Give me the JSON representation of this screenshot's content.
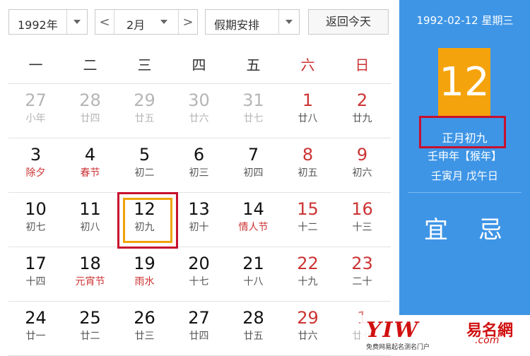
{
  "toolbar": {
    "year_select": "1992年",
    "month_select": "2月",
    "prev_arrow": "<",
    "next_arrow": ">",
    "holiday_select": "假期安排",
    "today_button": "返回今天"
  },
  "weekdays": [
    "一",
    "二",
    "三",
    "四",
    "五",
    "六",
    "日"
  ],
  "days": [
    {
      "num": "27",
      "sub": "小年",
      "other": true
    },
    {
      "num": "28",
      "sub": "廿四",
      "other": true
    },
    {
      "num": "29",
      "sub": "廿五",
      "other": true
    },
    {
      "num": "30",
      "sub": "廿六",
      "other": true
    },
    {
      "num": "31",
      "sub": "廿七",
      "other": true
    },
    {
      "num": "1",
      "sub": "廿八"
    },
    {
      "num": "2",
      "sub": "廿九"
    },
    {
      "num": "3",
      "sub": "除夕",
      "fest": true
    },
    {
      "num": "4",
      "sub": "春节",
      "fest": true
    },
    {
      "num": "5",
      "sub": "初二"
    },
    {
      "num": "6",
      "sub": "初三"
    },
    {
      "num": "7",
      "sub": "初四"
    },
    {
      "num": "8",
      "sub": "初五"
    },
    {
      "num": "9",
      "sub": "初六"
    },
    {
      "num": "10",
      "sub": "初七"
    },
    {
      "num": "11",
      "sub": "初八"
    },
    {
      "num": "12",
      "sub": "初九",
      "today": true
    },
    {
      "num": "13",
      "sub": "初十"
    },
    {
      "num": "14",
      "sub": "情人节",
      "fest": true
    },
    {
      "num": "15",
      "sub": "十二"
    },
    {
      "num": "16",
      "sub": "十三"
    },
    {
      "num": "17",
      "sub": "十四"
    },
    {
      "num": "18",
      "sub": "元宵节",
      "fest": true
    },
    {
      "num": "19",
      "sub": "雨水",
      "fest": true
    },
    {
      "num": "20",
      "sub": "十七"
    },
    {
      "num": "21",
      "sub": "十八"
    },
    {
      "num": "22",
      "sub": "十九"
    },
    {
      "num": "23",
      "sub": "二十"
    },
    {
      "num": "24",
      "sub": "廿一"
    },
    {
      "num": "25",
      "sub": "廿二"
    },
    {
      "num": "26",
      "sub": "廿三"
    },
    {
      "num": "27",
      "sub": "廿四"
    },
    {
      "num": "28",
      "sub": "廿五"
    },
    {
      "num": "29",
      "sub": "廿六"
    },
    {
      "num": "1",
      "sub": "廿七",
      "other": true
    }
  ],
  "panel": {
    "date_line": "1992-02-12 星期三",
    "big_day": "12",
    "lunar_date": "正月初九",
    "ganzhi_year": "壬申年【猴年】",
    "ganzhi_month_day": "壬寅月 戊午日",
    "yi": "宜",
    "ji": "忌"
  },
  "watermark": {
    "logo": "YIW",
    "name": "易名網",
    "com": ".com",
    "tagline": "免费网易起名测名门户"
  },
  "colors": {
    "panel_blue": "#3e95e6",
    "today_orange": "#f5a30c",
    "highlight_red": "#c8102e",
    "festival_red": "#cc3333"
  }
}
